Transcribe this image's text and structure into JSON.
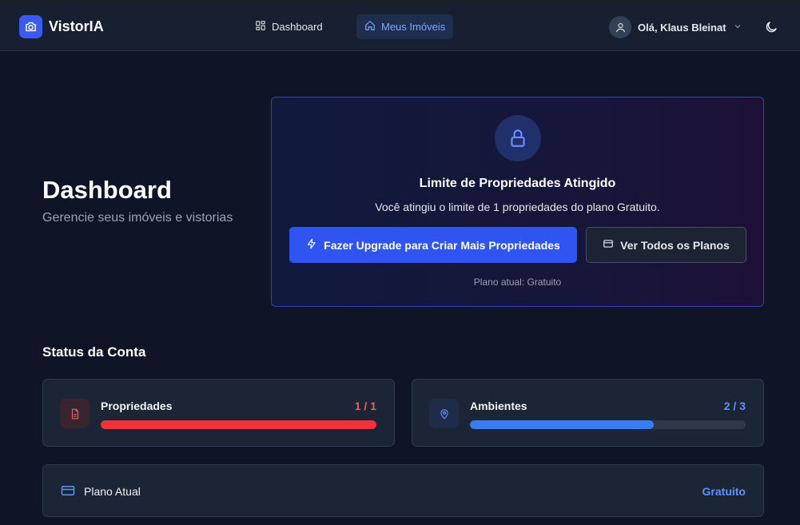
{
  "brand": {
    "name": "VistorIA",
    "icon": "camera-icon",
    "accent": "#3b5bf0"
  },
  "nav": {
    "items": [
      {
        "label": "Dashboard",
        "icon": "grid-icon",
        "active": false
      },
      {
        "label": "Meus Imóveis",
        "icon": "home-icon",
        "active": true
      }
    ]
  },
  "user": {
    "greeting": "Olá, Klaus Bleinat",
    "icon": "user-icon"
  },
  "theme_toggle": {
    "icon": "moon-icon"
  },
  "page": {
    "title": "Dashboard",
    "subtitle": "Gerencie seus imóveis e vistorias"
  },
  "limit_card": {
    "icon": "lock-icon",
    "title": "Limite de Propriedades Atingido",
    "description": "Você atingiu o limite de 1 propriedades do plano Gratuito.",
    "upgrade_button": "Fazer Upgrade para Criar Mais Propriedades",
    "plans_button": "Ver Todos os Planos",
    "current_plan_note": "Plano atual: Gratuito"
  },
  "status": {
    "title": "Status da Conta",
    "properties": {
      "label": "Propriedades",
      "count": "1 / 1",
      "progress": 1.0,
      "color": "#f0323a",
      "icon": "document-icon"
    },
    "environments": {
      "label": "Ambientes",
      "count": "2 / 3",
      "progress": 0.6667,
      "color": "#3b7bf0",
      "icon": "map-pin-icon"
    }
  },
  "plan": {
    "label": "Plano Atual",
    "value": "Gratuito",
    "icon": "credit-card-icon"
  }
}
